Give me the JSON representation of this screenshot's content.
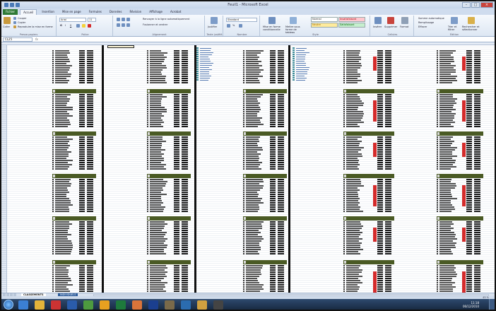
{
  "window": {
    "title": "Feuil1 - Microsoft Excel"
  },
  "ribbon": {
    "tabs": [
      "Fichier",
      "Accueil",
      "Insertion",
      "Mise en page",
      "Formules",
      "Données",
      "Révision",
      "Affichage",
      "Acrobat"
    ],
    "clipboard": {
      "paste": "Coller",
      "cut": "Couper",
      "copy": "Copier",
      "painter": "Reproduire la mise en forme",
      "label": "Presse-papiers"
    },
    "font": {
      "name": "Arial",
      "size": "11",
      "label": "Police"
    },
    "alignment": {
      "wrap": "Renvoyer à la ligne automatiquement",
      "merge": "Fusionner et centrer",
      "label": "Alignement"
    },
    "justify": {
      "btn": "Justifier",
      "label": "Texte justifié"
    },
    "number": {
      "format": "Standard",
      "label": "Nombre"
    },
    "styles": {
      "conditional": "Mise en forme conditionnelle",
      "table": "Mettre sous forme de tableau",
      "cells": [
        "Normal",
        "Insatisfaisant",
        "Neutre",
        "Satisfaisant"
      ],
      "label": "Style"
    },
    "cells": {
      "insert": "Insérer",
      "delete": "Supprimer",
      "format": "Format",
      "label": "Cellules"
    },
    "editing": {
      "autosum": "Somme automatique",
      "fill": "Remplissage",
      "clear": "Effacer",
      "sort": "Trier et filtrer",
      "find": "Rechercher et sélectionner",
      "label": "Édition"
    }
  },
  "formula_bar": {
    "namebox": "CL25",
    "fx": "fx"
  },
  "sheet_tabs": {
    "active": "CLASSEMENTS",
    "other": "INDIVIDUELS"
  },
  "status": {
    "zoom": "45 %"
  },
  "taskbar": {
    "apps": [
      "IE",
      "Explorer",
      "FileZilla",
      "Word",
      "Calc",
      "Chrome",
      "Excel",
      "Pictures",
      "Photoshop",
      "Gimp",
      "Outlook",
      "Folder",
      "Media"
    ],
    "time": "11:18",
    "date": "06/12/2010"
  },
  "colors": {
    "header_green": "#4a5a24",
    "red_highlight": "#d42b2b",
    "teal": "#3f8e9a"
  }
}
